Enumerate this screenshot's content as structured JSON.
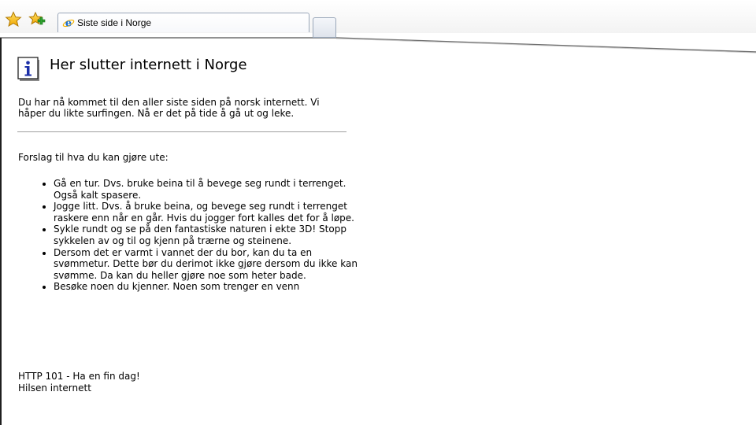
{
  "browser": {
    "tab": {
      "title": "Siste side i Norge"
    },
    "toolbar": {
      "favorites_icon": "favorites-star-icon",
      "add_favorites_icon": "add-to-favorites-icon",
      "tab_icon": "internet-explorer-icon"
    }
  },
  "page": {
    "title": "Her slutter internett i Norge",
    "intro": "Du har nå kommet til den aller siste siden på norsk internett. Vi håper du likte surfingen. Nå er det på tide å gå ut og leke.",
    "suggestions_heading": "Forslag til hva du kan gjøre ute:",
    "suggestions": [
      "Gå en tur. Dvs. bruke beina til å bevege seg rundt i terrenget. Også kalt spasere.",
      "Jogge litt. Dvs. å bruke beina, og bevege seg rundt i terrenget raskere enn når en går. Hvis du jogger fort kalles det for å løpe.",
      "Sykle rundt og se på den fantastiske naturen i ekte 3D! Stopp sykkelen av og til og kjenn på trærne og steinene.",
      "Dersom det er varmt i vannet der du bor, kan du ta en svømmetur. Dette bør du derimot ikke gjøre dersom du ikke kan svømme. Da kan du heller gjøre noe som heter bade.",
      "Besøke noen du kjenner. Noen som trenger en venn"
    ],
    "footer_line1": "HTTP 101 - Ha en fin dag!",
    "footer_line2": "Hilsen internett"
  },
  "colors": {
    "tab_border": "#9aa7b9",
    "divider": "#9e9e9e",
    "info_icon_blue": "#1c2fa8"
  }
}
